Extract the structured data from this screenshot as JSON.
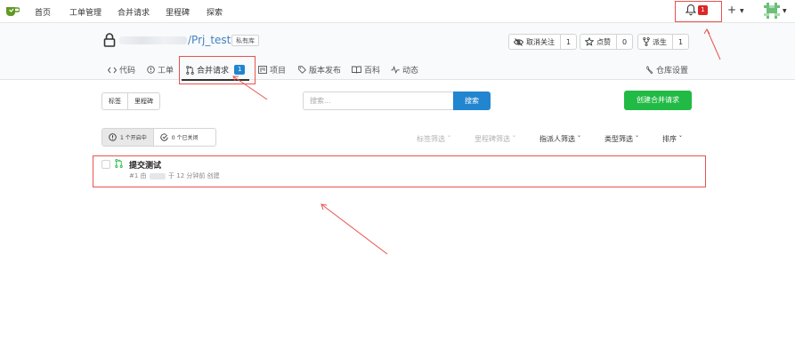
{
  "topnav": {
    "items": [
      "首页",
      "工单管理",
      "合并请求",
      "里程碑",
      "探索"
    ],
    "notification_count": "1",
    "plus_label": "+"
  },
  "repo": {
    "name": "Prj_test",
    "name_prefix": "/",
    "private_tag": "私有库",
    "unwatch_label": "取消关注",
    "watch_count": "1",
    "star_label": "点赞",
    "star_count": "0",
    "fork_label": "派生",
    "fork_count": "1"
  },
  "tabs": {
    "code": "代码",
    "issues": "工单",
    "pulls": "合并请求",
    "pulls_count": "1",
    "projects": "项目",
    "releases": "版本发布",
    "wiki": "百科",
    "activity": "动态",
    "settings": "仓库设置"
  },
  "toolbar": {
    "labels_btn": "标签",
    "milestones_btn": "里程碑",
    "search_placeholder": "搜索...",
    "search_btn": "搜索",
    "create_btn": "创建合并请求"
  },
  "states": {
    "open": "1 个开启中",
    "closed": "0 个已关闭"
  },
  "filters": [
    {
      "label": "标签筛选 ˇ",
      "active": false
    },
    {
      "label": "里程碑筛选 ˇ",
      "active": false
    },
    {
      "label": "指派人筛选 ˇ",
      "active": true
    },
    {
      "label": "类型筛选 ˇ",
      "active": true
    },
    {
      "label": "排序 ˇ",
      "active": true
    }
  ],
  "pr_list": [
    {
      "title": "提交测试",
      "meta_prefix": "#1 由",
      "meta_suffix": "于 12 分钟前 创建"
    }
  ],
  "colors": {
    "primary": "#2185d0",
    "success": "#21ba45",
    "danger": "#db2828",
    "annotation": "#e8534e",
    "pr_icon": "#21ba45"
  }
}
